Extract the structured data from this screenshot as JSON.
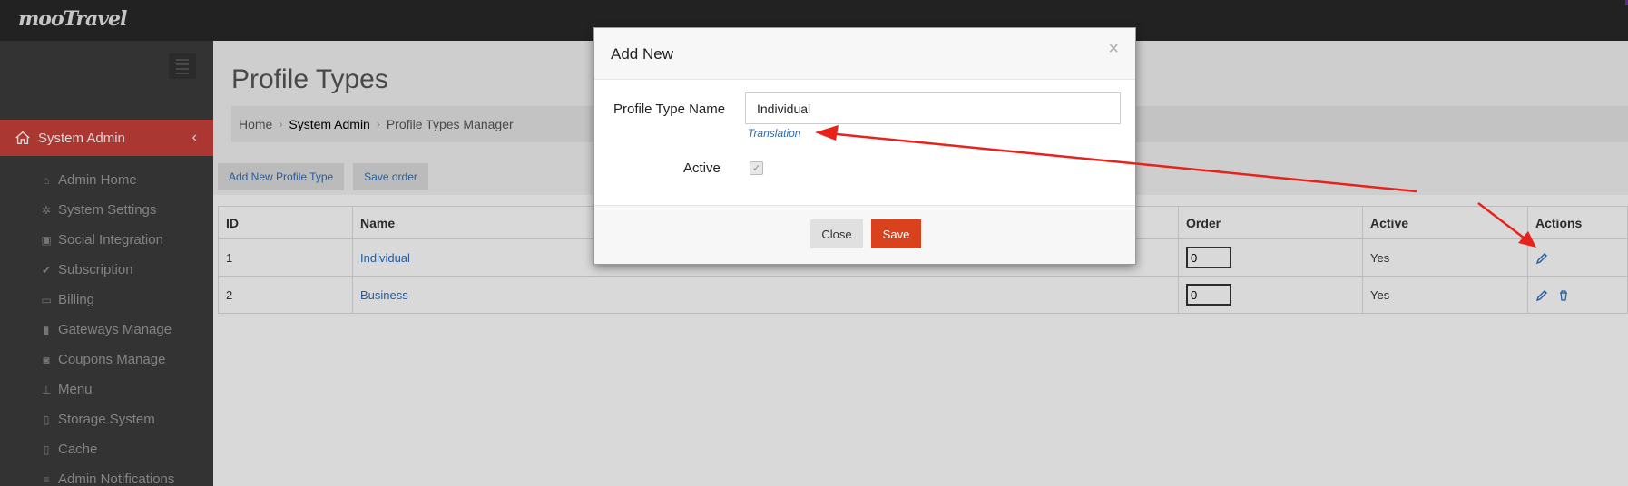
{
  "app": {
    "logo": "mooTravel"
  },
  "sidebar": {
    "section_label": "System Admin",
    "items": [
      {
        "label": "Admin Home",
        "icon": "home-icon"
      },
      {
        "label": "System Settings",
        "icon": "gear-icon"
      },
      {
        "label": "Social Integration",
        "icon": "share-icon"
      },
      {
        "label": "Subscription",
        "icon": "check-icon"
      },
      {
        "label": "Billing",
        "icon": "credit-card-icon"
      },
      {
        "label": "Gateways Manage",
        "icon": "gateway-icon"
      },
      {
        "label": "Coupons Manage",
        "icon": "money-icon"
      },
      {
        "label": "Menu",
        "icon": "sitemap-icon"
      },
      {
        "label": "Storage System",
        "icon": "file-icon"
      },
      {
        "label": "Cache",
        "icon": "file-icon"
      },
      {
        "label": "Admin Notifications",
        "icon": "list-icon"
      }
    ]
  },
  "page": {
    "title": "Profile Types",
    "breadcrumb": [
      "Home",
      "System Admin",
      "Profile Types Manager"
    ],
    "buttons": {
      "add_new": "Add New Profile Type",
      "save_order": "Save order"
    }
  },
  "table": {
    "headers": [
      "ID",
      "Name",
      "Order",
      "Active",
      "Actions"
    ],
    "rows": [
      {
        "id": "1",
        "name": "Individual",
        "order": "0",
        "active": "Yes"
      },
      {
        "id": "2",
        "name": "Business",
        "order": "0",
        "active": "Yes"
      }
    ]
  },
  "modal": {
    "title": "Add New",
    "close_x": "×",
    "profile_type_label": "Profile Type Name",
    "profile_type_value": "Individual",
    "translation_link": "Translation",
    "active_label": "Active",
    "close_button": "Close",
    "save_button": "Save"
  },
  "colors": {
    "accent_red": "#c9413b",
    "save_orange": "#d9421c",
    "link_blue": "#2a6ebb",
    "annotation_red": "#e8221b"
  }
}
